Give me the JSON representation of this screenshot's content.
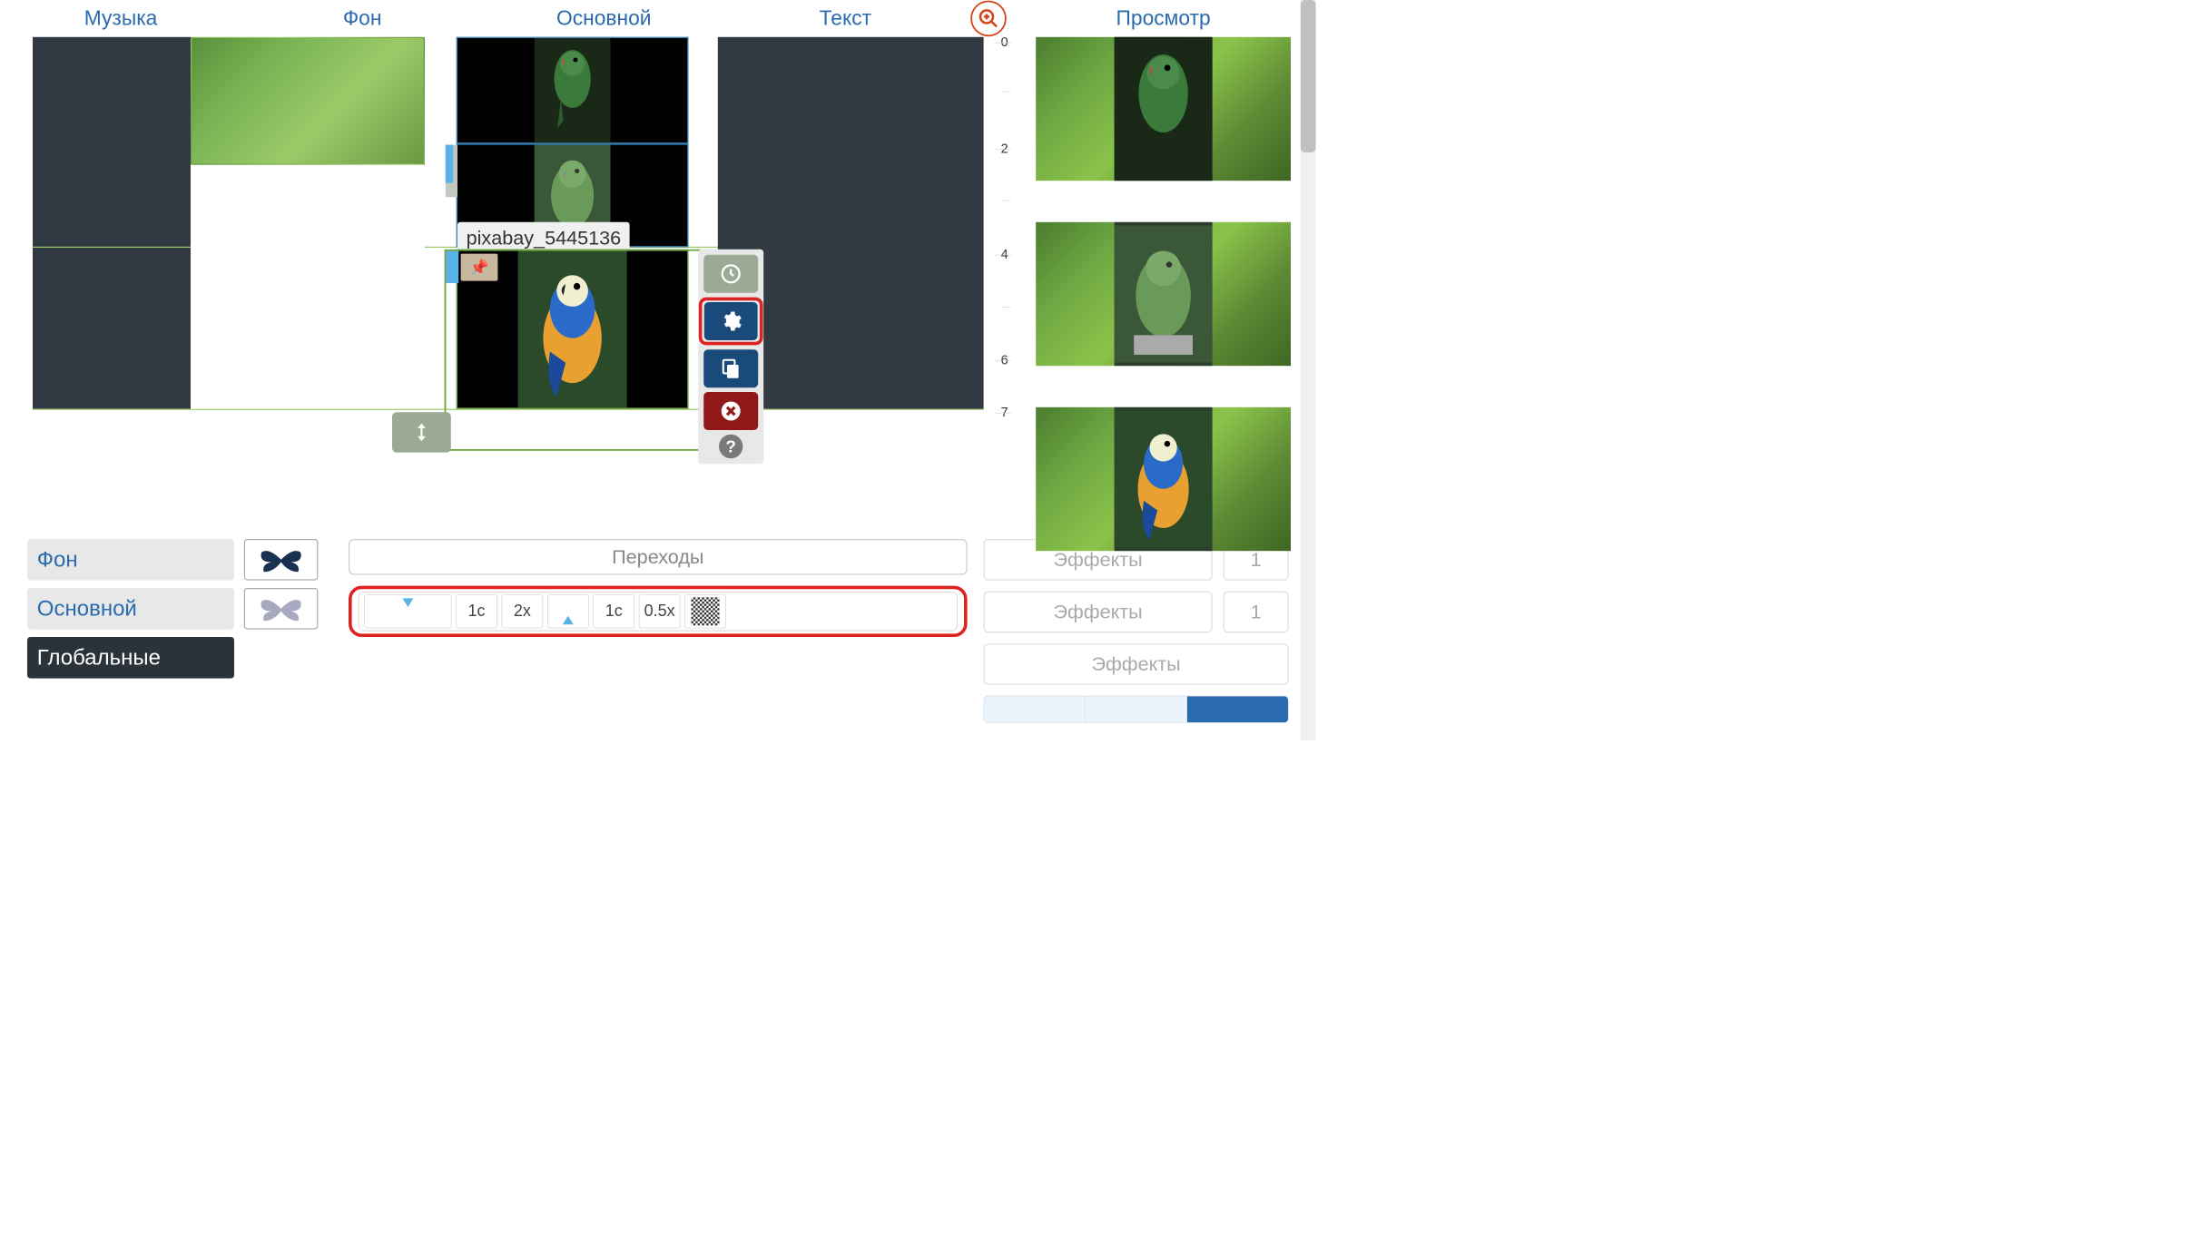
{
  "tabs": {
    "music": "Музыка",
    "background": "Фон",
    "main": "Основной",
    "text": "Текст",
    "preview": "Просмотр"
  },
  "ruler": {
    "marks": [
      "0",
      "2",
      "4",
      "6",
      "7"
    ]
  },
  "clip_label": "pixabay_5445136",
  "layers": {
    "background": "Фон",
    "main": "Основной",
    "global": "Глобальные"
  },
  "transitions": {
    "label": "Переходы",
    "cells": {
      "in_time": "1с",
      "in_speed": "2x",
      "out_time": "1с",
      "out_speed": "0.5x"
    }
  },
  "effects": {
    "label": "Эффекты",
    "count": "1"
  }
}
